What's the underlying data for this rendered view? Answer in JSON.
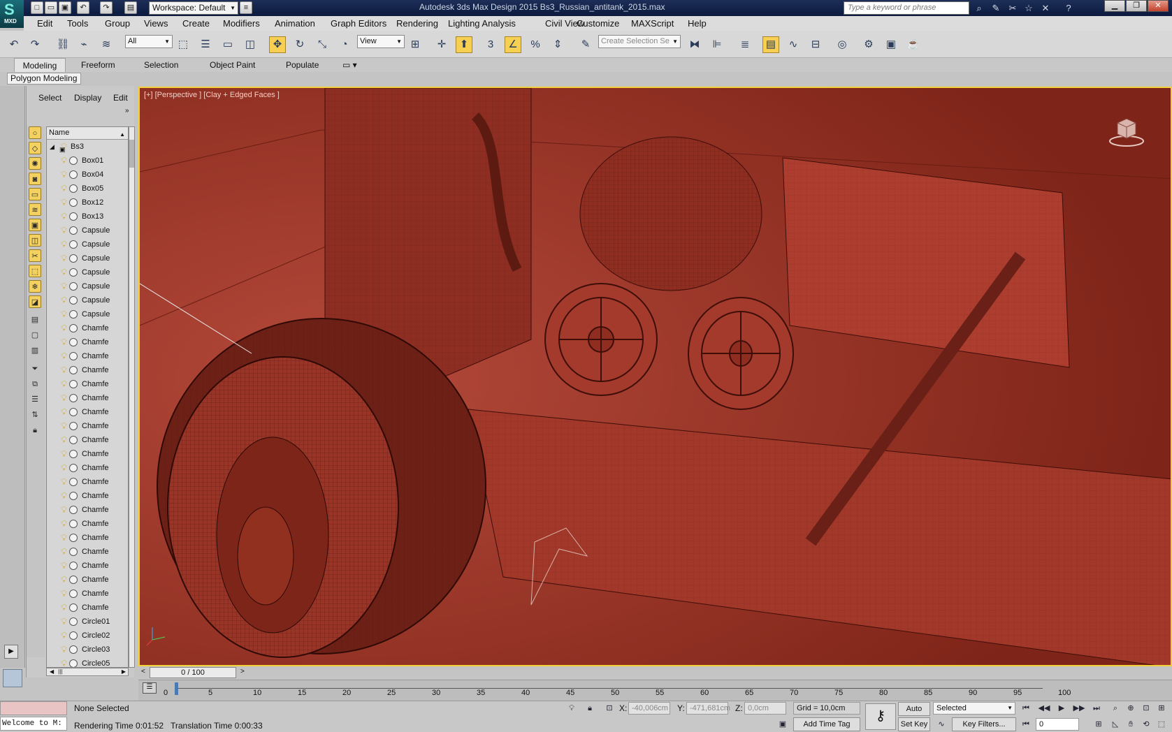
{
  "window": {
    "title": "Autodesk 3ds Max Design 2015      Bs3_Russian_antitank_2015.max",
    "workspace": "Workspace: Default",
    "search_placeholder": "Type a keyword or phrase",
    "logo_text": "MXD"
  },
  "menu": [
    "Edit",
    "Tools",
    "Group",
    "Views",
    "Create",
    "Modifiers",
    "Animation",
    "Graph Editors",
    "Rendering",
    "Lighting Analysis",
    "Civil View",
    "Customize",
    "MAXScript",
    "Help"
  ],
  "toolbar": {
    "selection_filter": "All",
    "ref_coord": "View",
    "named_selection_placeholder": "Create Selection Se",
    "snap_label": "3"
  },
  "ribbon": {
    "tabs": [
      "Modeling",
      "Freeform",
      "Selection",
      "Object Paint",
      "Populate"
    ],
    "active_tab": "Modeling",
    "panel_label": "Polygon Modeling"
  },
  "explorer": {
    "menus": [
      "Select",
      "Display",
      "Edit"
    ],
    "column_header": "Name",
    "root": "Bs3",
    "items": [
      "Box01",
      "Box04",
      "Box05",
      "Box12",
      "Box13",
      "Capsule",
      "Capsule",
      "Capsule",
      "Capsule",
      "Capsule",
      "Capsule",
      "Capsule",
      "Chamfe",
      "Chamfe",
      "Chamfe",
      "Chamfe",
      "Chamfe",
      "Chamfe",
      "Chamfe",
      "Chamfe",
      "Chamfe",
      "Chamfe",
      "Chamfe",
      "Chamfe",
      "Chamfe",
      "Chamfe",
      "Chamfe",
      "Chamfe",
      "Chamfe",
      "Chamfe",
      "Chamfe",
      "Chamfe",
      "Chamfe",
      "Circle01",
      "Circle02",
      "Circle03",
      "Circle05"
    ]
  },
  "viewport": {
    "label": "[+] [Perspective ] [Clay + Edged Faces ]",
    "background": "#9b3426"
  },
  "timeline": {
    "frame": "0 / 100",
    "ticks": [
      "0",
      "5",
      "10",
      "15",
      "20",
      "25",
      "30",
      "35",
      "40",
      "45",
      "50",
      "55",
      "60",
      "65",
      "70",
      "75",
      "80",
      "85",
      "90",
      "95",
      "100"
    ]
  },
  "status": {
    "maxscript_listener": "Welcome to M:",
    "selection": "None Selected",
    "prompt": "Rendering Time  0:01:52",
    "translation_time": "Translation Time  0:00:33",
    "x_label": "X:",
    "x_value": "-40,006cm",
    "y_label": "Y:",
    "y_value": "-471,681cm",
    "z_label": "Z:",
    "z_value": "0,0cm",
    "grid": "Grid = 10,0cm",
    "add_time_tag": "Add Time Tag",
    "auto_key": "Auto Key",
    "set_key": "Set Key",
    "key_mode": "Selected",
    "key_filters": "Key Filters...",
    "current_frame": "0"
  }
}
